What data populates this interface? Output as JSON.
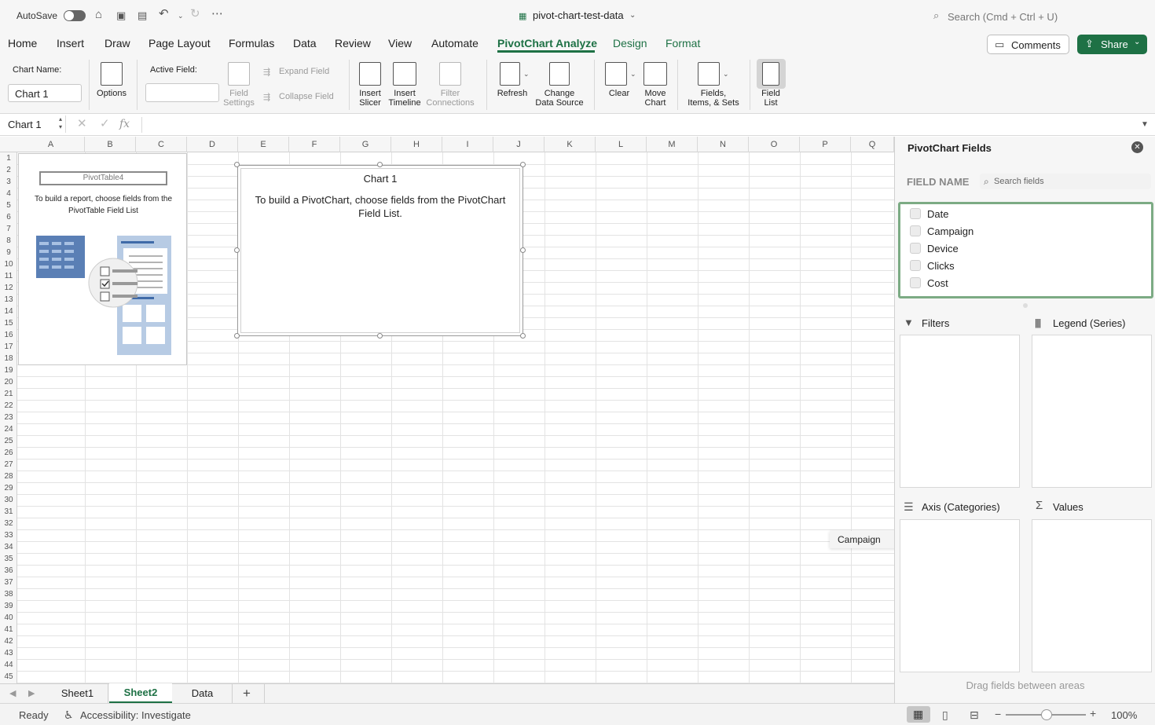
{
  "titlebar": {
    "autosave_label": "AutoSave",
    "file_name": "pivot-chart-test-data",
    "search_placeholder": "Search (Cmd + Ctrl + U)"
  },
  "tabs": [
    "Home",
    "Insert",
    "Draw",
    "Page Layout",
    "Formulas",
    "Data",
    "Review",
    "View",
    "Automate",
    "PivotChart Analyze",
    "Design",
    "Format"
  ],
  "active_tab": "PivotChart Analyze",
  "buttons": {
    "comments": "Comments",
    "share": "Share"
  },
  "ribbon": {
    "chart_name_label": "Chart Name:",
    "chart_name_value": "Chart 1",
    "options": "Options",
    "active_field_label": "Active Field:",
    "field_settings": [
      "Field",
      "Settings"
    ],
    "expand_field": "Expand Field",
    "collapse_field": "Collapse Field",
    "insert_slicer": [
      "Insert",
      "Slicer"
    ],
    "insert_timeline": [
      "Insert",
      "Timeline"
    ],
    "filter_connections": [
      "Filter",
      "Connections"
    ],
    "refresh": "Refresh",
    "change_data_source": [
      "Change",
      "Data Source"
    ],
    "clear": "Clear",
    "move_chart": [
      "Move",
      "Chart"
    ],
    "fields_items_sets": [
      "Fields,",
      "Items, & Sets"
    ],
    "field_list": [
      "Field",
      "List"
    ]
  },
  "formula_bar": {
    "name_box": "Chart 1",
    "fx": "fx"
  },
  "columns": [
    "A",
    "B",
    "C",
    "D",
    "E",
    "F",
    "G",
    "H",
    "I",
    "J",
    "K",
    "L",
    "M",
    "N",
    "O",
    "P",
    "Q"
  ],
  "rows": [
    "1",
    "2",
    "3",
    "4",
    "5",
    "6",
    "7",
    "8",
    "9",
    "10",
    "11",
    "12",
    "13",
    "14",
    "15",
    "16",
    "17",
    "18",
    "19",
    "20",
    "21",
    "22",
    "23",
    "24",
    "25",
    "26",
    "27",
    "28",
    "29",
    "30",
    "31",
    "32",
    "33",
    "34",
    "35",
    "36",
    "37",
    "38",
    "39",
    "40",
    "41",
    "42",
    "43",
    "44",
    "45"
  ],
  "pivot_table": {
    "name": "PivotTable4",
    "instruction": "To build a report, choose fields from the PivotTable Field List"
  },
  "chart": {
    "title": "Chart 1",
    "instruction": "To build a PivotChart, choose fields from the PivotChart Field List."
  },
  "drag_tooltip": "Campaign",
  "sheets": [
    "Sheet1",
    "Sheet2",
    "Data"
  ],
  "active_sheet": "Sheet2",
  "status": {
    "ready": "Ready",
    "accessibility": "Accessibility: Investigate",
    "zoom": "100%"
  },
  "pane": {
    "title": "PivotChart Fields",
    "field_name_label": "FIELD NAME",
    "search_placeholder": "Search fields",
    "fields": [
      "Date",
      "Campaign",
      "Device",
      "Clicks",
      "Cost"
    ],
    "filters": "Filters",
    "legend": "Legend (Series)",
    "axis": "Axis (Categories)",
    "values": "Values",
    "hint": "Drag fields between areas"
  },
  "colors": {
    "accent": "#1e7145",
    "share_bg": "#1e7145",
    "pane_border": "#7cab84"
  }
}
